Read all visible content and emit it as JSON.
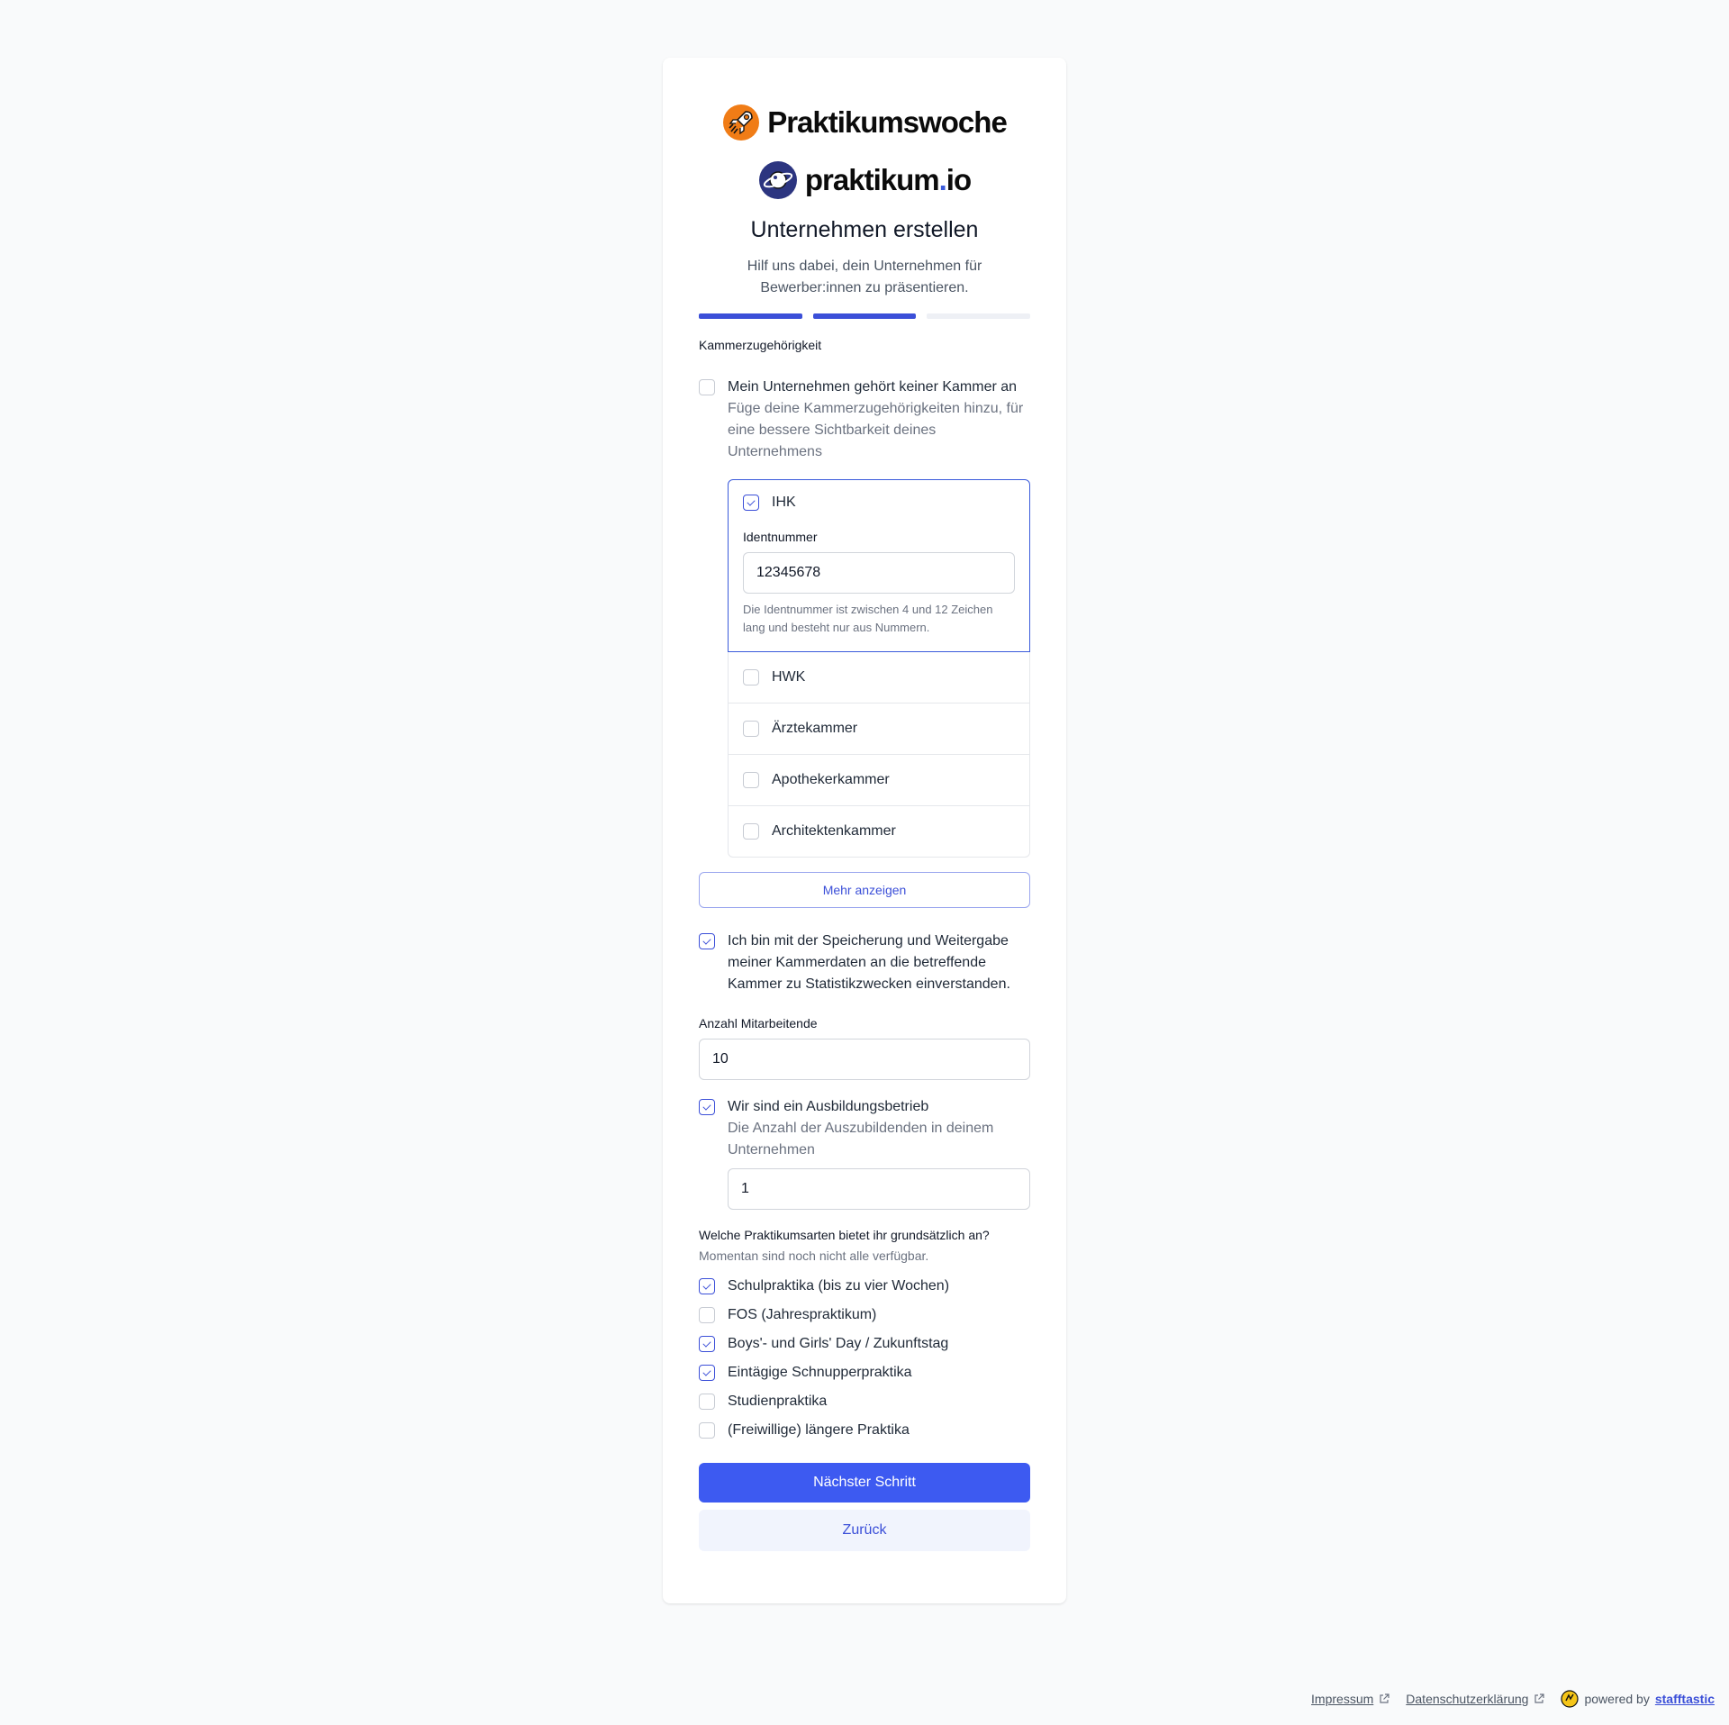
{
  "header": {
    "brand1": "Praktikumswoche",
    "brand2_main": "praktikum",
    "brand2_dot": ".",
    "brand2_tld": "io",
    "title": "Unternehmen erstellen",
    "subtitle": "Hilf uns dabei, dein Unternehmen für Bewerber:innen zu präsentieren."
  },
  "progress": {
    "steps_total": 3,
    "steps_done": 2,
    "color_done": "#3b4fd8",
    "color_todo": "#eef0f5"
  },
  "kammer": {
    "section_label": "Kammerzugehörigkeit",
    "no_kammer_label": "Mein Unternehmen gehört keiner Kammer an",
    "no_kammer_checked": false,
    "help": "Füge deine Kammerzugehörigkeiten hinzu, für eine bessere Sichtbarkeit deines Unternehmens",
    "items": [
      {
        "label": "IHK",
        "checked": true
      },
      {
        "label": "HWK",
        "checked": false
      },
      {
        "label": "Ärztekammer",
        "checked": false
      },
      {
        "label": "Apothekerkammer",
        "checked": false
      },
      {
        "label": "Architektenkammer",
        "checked": false
      }
    ],
    "ident_label": "Identnummer",
    "ident_value": "12345678",
    "ident_help": "Die Identnummer ist zwischen 4 und 12 Zeichen lang und besteht nur aus Nummern.",
    "more_button": "Mehr anzeigen",
    "consent_label": "Ich bin mit der Speicherung und Weitergabe meiner Kammerdaten an die betreffende Kammer zu Statistikzwecken einverstanden.",
    "consent_checked": true
  },
  "employees": {
    "label": "Anzahl Mitarbeitende",
    "value": "10"
  },
  "training": {
    "label": "Wir sind ein Ausbildungsbetrieb",
    "checked": true,
    "help": "Die Anzahl der Auszubildenden in deinem Unternehmen",
    "value": "1"
  },
  "types": {
    "label": "Welche Praktikumsarten bietet ihr grundsätzlich an?",
    "help": "Momentan sind noch nicht alle verfügbar.",
    "items": [
      {
        "label": "Schulpraktika (bis zu vier Wochen)",
        "checked": true
      },
      {
        "label": "FOS (Jahrespraktikum)",
        "checked": false
      },
      {
        "label": "Boys'- und Girls' Day / Zukunftstag",
        "checked": true
      },
      {
        "label": "Eintägige Schnupperpraktika",
        "checked": true
      },
      {
        "label": "Studienpraktika",
        "checked": false
      },
      {
        "label": "(Freiwillige) längere Praktika",
        "checked": false
      }
    ]
  },
  "actions": {
    "next": "Nächster Schritt",
    "back": "Zurück"
  },
  "footer": {
    "impressum": "Impressum",
    "datenschutz": "Datenschutzerklärung",
    "powered_by": "powered by",
    "powered_brand": "stafftastic"
  },
  "colors": {
    "accent": "#3d5af1",
    "logo1_orange": "#f07c16",
    "logo2_navy": "#2c3580"
  },
  "icons": [
    "rocket-logo-icon",
    "planet-logo-icon",
    "external-link-icon",
    "stafftastic-logo-icon"
  ]
}
